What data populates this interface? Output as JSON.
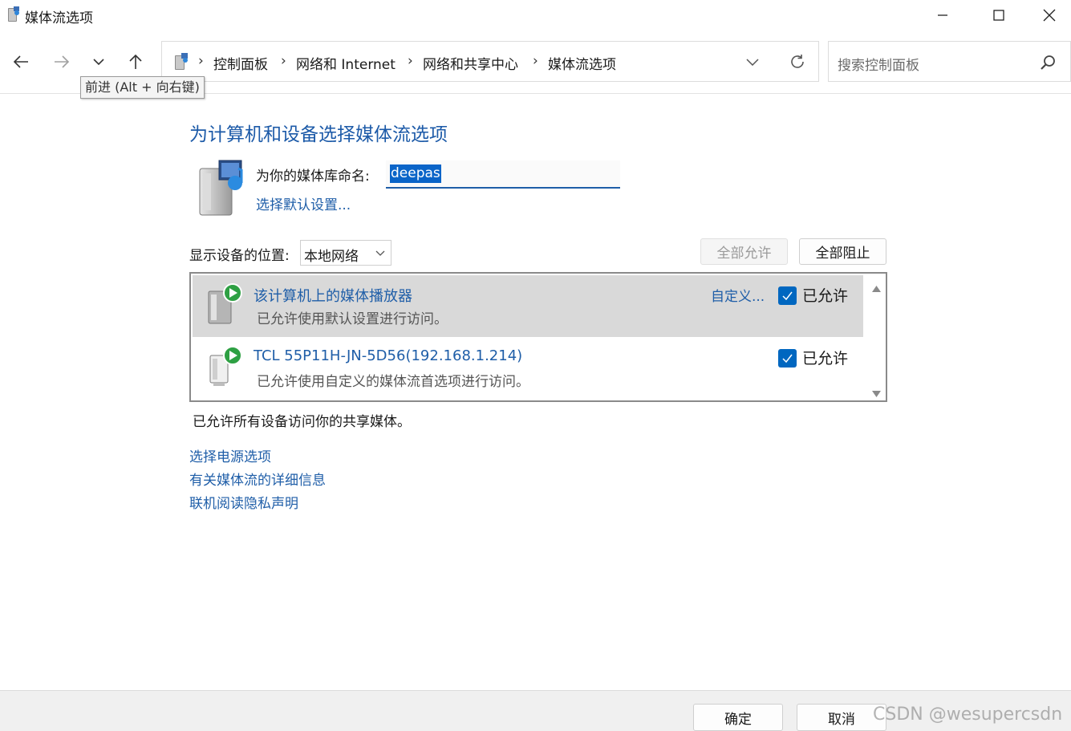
{
  "window": {
    "title": "媒体流选项",
    "minimize_label": "",
    "maximize_label": "",
    "close_label": ""
  },
  "nav": {
    "tooltip": "前进 (Alt + 向右键)",
    "breadcrumbs": [
      "控制面板",
      "网络和 Internet",
      "网络和共享中心",
      "媒体流选项"
    ],
    "search_placeholder": "搜索控制面板"
  },
  "main": {
    "heading": "为计算机和设备选择媒体流选项",
    "library_label": "为你的媒体库命名:",
    "library_name": "deepas",
    "choose_defaults_link": "选择默认设置...",
    "show_devices_label": "显示设备的位置:",
    "show_devices_value": "本地网络",
    "allow_all_button": "全部允许",
    "block_all_button": "全部阻止",
    "devices": [
      {
        "name": "该计算机上的媒体播放器",
        "description": "已允许使用默认设置进行访问。",
        "customize_link": "自定义...",
        "allowed_label": "已允许",
        "allowed": true
      },
      {
        "name": "TCL 55P11H-JN-5D56(192.168.1.214)",
        "description": "已允许使用自定义的媒体流首选项进行访问。",
        "allowed_label": "已允许",
        "allowed": true
      }
    ],
    "status_text": "已允许所有设备访问你的共享媒体。",
    "links": {
      "power": "选择电源选项",
      "more_info": "有关媒体流的详细信息",
      "privacy": "联机阅读隐私声明"
    }
  },
  "footer": {
    "ok_button": "确定",
    "cancel_button": "取消",
    "watermark": "CSDN @wesupercsdn"
  },
  "colors": {
    "link": "#1f5ea8",
    "heading": "#1c5aa8",
    "checkbox": "#0067c0",
    "selected_row": "#d9d9d9"
  }
}
